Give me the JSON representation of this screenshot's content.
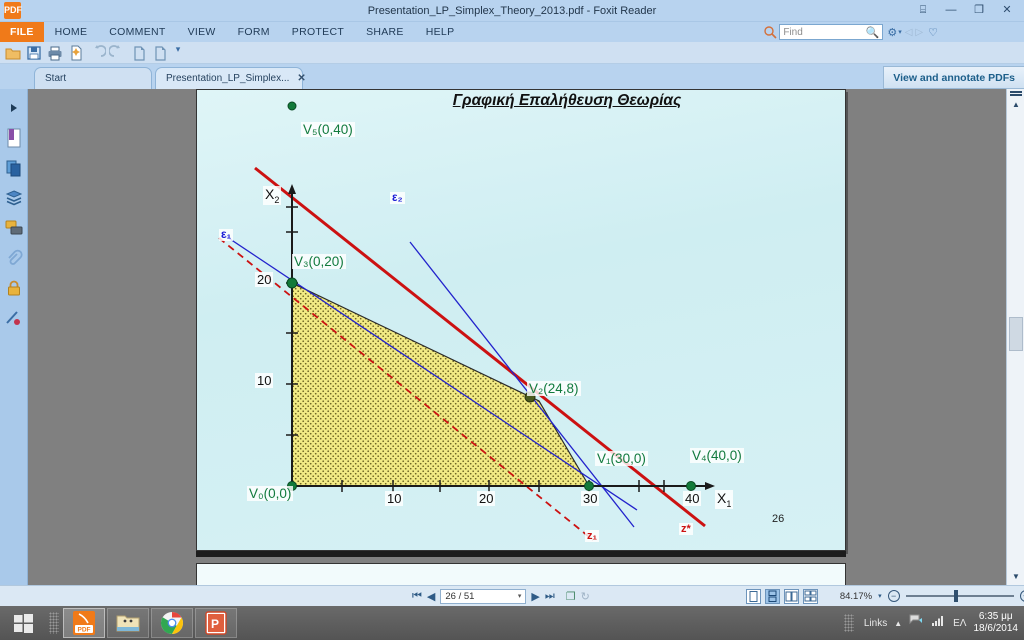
{
  "window": {
    "title": "Presentation_LP_Simplex_Theory_2013.pdf - Foxit Reader",
    "logo_text": "PDF",
    "controls": [
      {
        "name": "ribbon-options",
        "glyph": "⌸"
      },
      {
        "name": "minimize",
        "glyph": "—"
      },
      {
        "name": "restore",
        "glyph": "❐"
      },
      {
        "name": "close",
        "glyph": "✕"
      }
    ]
  },
  "menu": {
    "file_label": "FILE",
    "items": [
      "HOME",
      "COMMENT",
      "VIEW",
      "FORM",
      "PROTECT",
      "SHARE",
      "HELP"
    ]
  },
  "search": {
    "placeholder": "Find",
    "value": ""
  },
  "quick_toolbar": [
    {
      "name": "open-file-icon",
      "glyph": "📂",
      "color": "#e8a33d"
    },
    {
      "name": "save-icon",
      "glyph": "💾",
      "color": "#3b6ea5"
    },
    {
      "name": "print-icon",
      "glyph": "🖨",
      "color": "#4a6a8a"
    },
    {
      "name": "create-pdf-icon",
      "glyph": "⬜",
      "color": "#e8a33d"
    },
    {
      "name": "undo-icon",
      "glyph": "↶",
      "color": "#9ab4cc"
    },
    {
      "name": "redo-icon",
      "glyph": "↷",
      "color": "#9ab4cc"
    },
    {
      "name": "previous-page-icon",
      "glyph": "◱",
      "color": "#6f93b5"
    },
    {
      "name": "next-page-icon",
      "glyph": "◱",
      "color": "#6f93b5"
    },
    {
      "name": "customize-toolbar-icon",
      "glyph": "▾",
      "color": "#3b6ea5"
    }
  ],
  "tabs": [
    {
      "label": "Start",
      "active": false,
      "closable": false
    },
    {
      "label": "Presentation_LP_Simplex...",
      "active": true,
      "closable": true,
      "close_glyph": "✕"
    }
  ],
  "promo_button": {
    "label": "View and annotate PDFs",
    "caret": "▾"
  },
  "sidebar": {
    "items": [
      {
        "name": "expand-panel-icon",
        "glyph": "▶"
      },
      {
        "name": "bookmarks-icon",
        "glyph": "🔖"
      },
      {
        "name": "page-thumbnails-icon",
        "glyph": "▤"
      },
      {
        "name": "layers-icon",
        "glyph": "≣"
      },
      {
        "name": "comments-icon",
        "glyph": "💬"
      },
      {
        "name": "attachments-icon",
        "glyph": "📎"
      },
      {
        "name": "security-icon",
        "glyph": "🔒"
      },
      {
        "name": "signature-icon",
        "glyph": "✎"
      }
    ]
  },
  "slide": {
    "title": "Γραφική Επαλήθευση Θεωρίας",
    "page_number": "26"
  },
  "chart_data": {
    "type": "scatter",
    "title": "Γραφική Επαλήθευση Θεωρίας",
    "xlabel": "X₁",
    "ylabel": "X₂",
    "xlim": [
      0,
      45
    ],
    "ylim": [
      0,
      42
    ],
    "xticks": [
      10,
      20,
      30,
      40
    ],
    "yticks": [
      10,
      20
    ],
    "grid": false,
    "legend": "none",
    "vertices": [
      {
        "label": "V₀(0,0)",
        "sub": "0",
        "name": "V",
        "text": "(0,0)",
        "x": 0,
        "y": 0,
        "marker": true
      },
      {
        "label": "V₁(30,0)",
        "sub": "1",
        "name": "V",
        "text": "(30,0)",
        "x": 30,
        "y": 0,
        "marker": true
      },
      {
        "label": "V₂(24,8)",
        "sub": "2",
        "name": "V",
        "text": "(24,8)",
        "x": 24,
        "y": 8,
        "marker": true
      },
      {
        "label": "V₃(0,20)",
        "sub": "3",
        "name": "V",
        "text": "(0,20)",
        "x": 0,
        "y": 20,
        "marker": true
      },
      {
        "label": "V₄(40,0)",
        "sub": "4",
        "name": "V",
        "text": "(40,0)",
        "x": 40,
        "y": 0,
        "marker": true
      },
      {
        "label": "V₅(0,40)",
        "sub": "5",
        "name": "V",
        "text": "(0,40)",
        "x": 0,
        "y": 40,
        "marker": true
      }
    ],
    "lines": [
      {
        "name": "ε₁",
        "label": "ε₁",
        "color": "#2222cc",
        "style": "solid",
        "through": [
          [
            0,
            20
          ],
          [
            40,
            0
          ]
        ],
        "description": "constraint line epsilon-1"
      },
      {
        "name": "ε₂",
        "label": "ε₂",
        "color": "#2222cc",
        "style": "solid",
        "through": [
          [
            0,
            40
          ],
          [
            30,
            0
          ]
        ],
        "description": "constraint line epsilon-2"
      },
      {
        "name": "z₁",
        "label": "z₁",
        "color": "#cc1111",
        "style": "dashed",
        "through": [
          [
            0,
            20
          ],
          [
            25,
            0
          ]
        ],
        "description": "objective iso-profit line z1"
      },
      {
        "name": "z*",
        "label": "z*",
        "color": "#cc1111",
        "style": "solid",
        "through": [
          [
            0,
            40
          ],
          [
            36,
            0
          ]
        ],
        "description": "optimal objective line z*"
      }
    ],
    "feasible_region": {
      "name": "feasible-region",
      "fill": "#f2ea84",
      "pattern": "dotted",
      "polygon": [
        [
          0,
          0
        ],
        [
          0,
          20
        ],
        [
          24,
          8
        ],
        [
          30,
          0
        ]
      ]
    },
    "axis_labels": {
      "x": "X",
      "x_sub": "1",
      "y": "X",
      "y_sub": "2"
    },
    "tick_labels_x": [
      "10",
      "20",
      "30",
      "40"
    ],
    "tick_labels_y": [
      "10",
      "20"
    ]
  },
  "statusbar": {
    "first_page_glyph": "⏮",
    "prev_page_glyph": "◀",
    "page_value": "26 / 51",
    "page_caret": "▾",
    "next_page_glyph": "▶",
    "last_page_glyph": "⏭",
    "fit_page_glyph": "❐",
    "rotate_glyph": "↻",
    "view_modes": [
      {
        "name": "single-page-view",
        "glyph": "▤",
        "active": false
      },
      {
        "name": "continuous-view",
        "glyph": "▦",
        "active": true
      },
      {
        "name": "facing-view",
        "glyph": "◫",
        "active": false
      },
      {
        "name": "continuous-facing-view",
        "glyph": "☷",
        "active": false
      }
    ],
    "zoom_value": "84.17%",
    "zoom_caret": "▾",
    "zoom_out_glyph": "−",
    "zoom_in_glyph": "+"
  },
  "taskbar": {
    "start_glyph": "⊞",
    "buttons": [
      {
        "name": "taskbar-foxit-reader",
        "label": "PDF",
        "active": true
      },
      {
        "name": "taskbar-file-explorer",
        "label": "",
        "active": false
      },
      {
        "name": "taskbar-google-chrome",
        "label": "",
        "active": false
      },
      {
        "name": "taskbar-powerpoint",
        "label": "P",
        "active": false
      }
    ],
    "tray": {
      "links_label": "Links",
      "expand_glyph": "▲",
      "network_glyph": "⬛",
      "volume_glyph": "◰",
      "language": "ΕΛ",
      "time": "6:35 μμ",
      "date": "18/6/2014"
    }
  },
  "colors": {
    "accent_orange": "#f07a19",
    "titlebar_blue": "#b8d3ef",
    "region_yellow": "#f2ea84",
    "vertex_green": "#117a3d",
    "line_blue": "#2222cc",
    "line_red": "#cc1111",
    "slide_bg": "#d9f2f5"
  }
}
